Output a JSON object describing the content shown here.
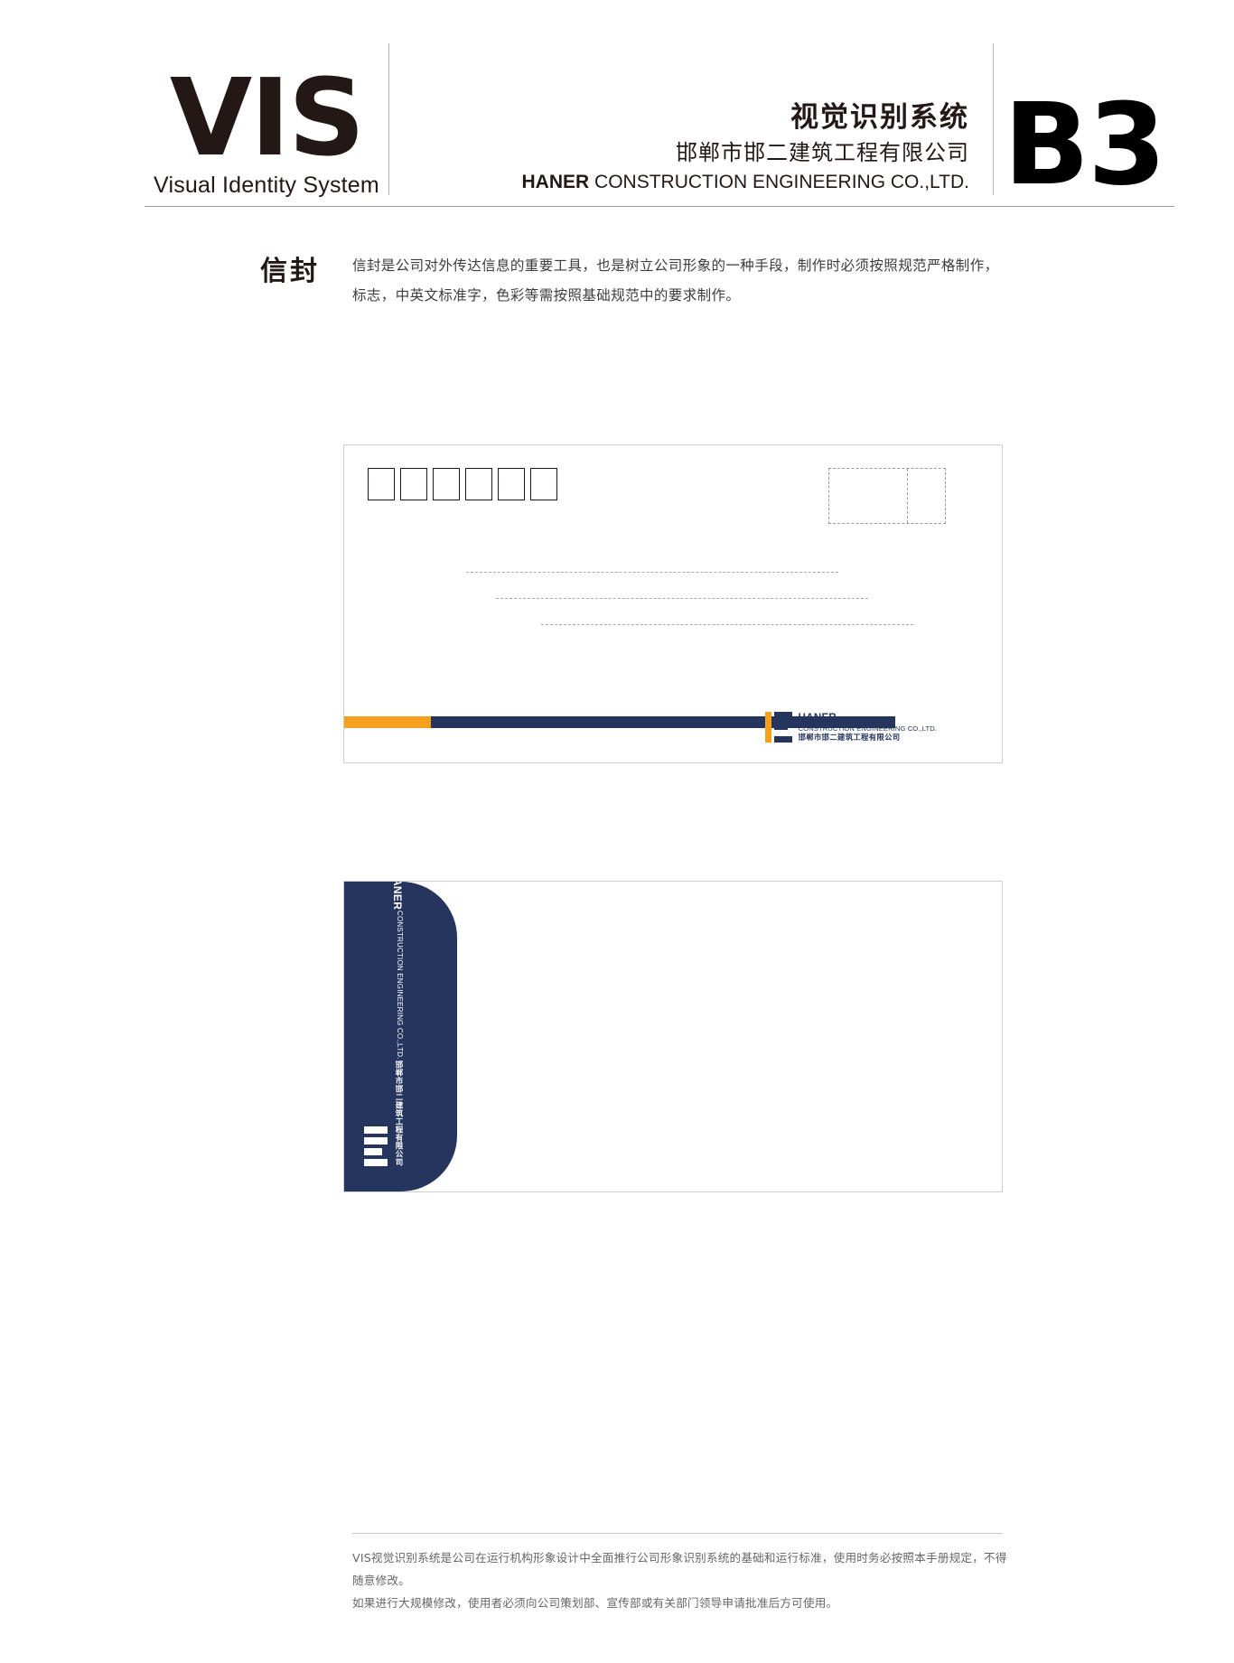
{
  "header": {
    "vis_word": "VIS",
    "vis_subtitle": "Visual Identity System",
    "title_cn": "视觉识别系统",
    "company_cn": "邯郸市邯二建筑工程有限公司",
    "company_en_bold": "HANER",
    "company_en_rest": " CONSTRUCTION ENGINEERING CO.,LTD.",
    "page_code": "B3"
  },
  "section": {
    "title": "信封",
    "description": "信封是公司对外传达信息的重要工具，也是树立公司形象的一种手段，制作时必须按照规范严格制作，标志，中英文标准字，色彩等需按照基础规范中的要求制作。"
  },
  "envelope_front": {
    "postcode_box_count": 6,
    "stamp_label": "",
    "address_line_count": 3,
    "bar_orange_color": "#f5a11d",
    "bar_navy_color": "#25355e",
    "logo_name": "HANER",
    "logo_en": "CONSTRUCTION ENGINEERING CO.,LTD.",
    "logo_cn": "邯郸市邯二建筑工程有限公司"
  },
  "envelope_back": {
    "flap_color": "#25355e",
    "logo_name": "HANER",
    "logo_en": "CONSTRUCTION ENGINEERING CO.,LTD.",
    "logo_cn": "邯郸市邯二建筑工程有限公司"
  },
  "footer": {
    "line1": "VIS视觉识别系统是公司在运行机构形象设计中全面推行公司形象识别系统的基础和运行标准，使用时务必按照本手册规定，不得随意修改。",
    "line2": "如果进行大规模修改，使用者必须向公司策划部、宣传部或有关部门领导申请批准后方可使用。"
  }
}
